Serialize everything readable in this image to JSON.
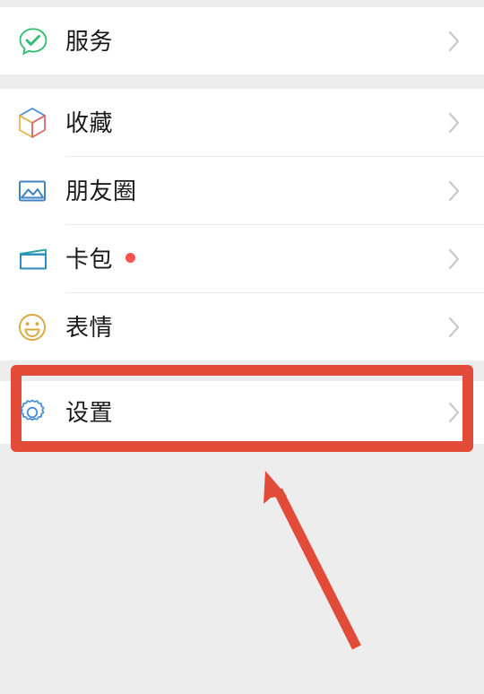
{
  "app": {
    "name": "WeChat Me tab",
    "background_color": "#ededed",
    "card_color": "#ffffff",
    "divider_color": "#e9e9e9",
    "label_color": "#1a1a1a",
    "chevron_color": "#c8c8c8",
    "badge_color": "#fa5151",
    "annotation_color": "#e24b38"
  },
  "groups": [
    {
      "id": "services-group",
      "items": [
        {
          "id": "services",
          "label": "服务",
          "icon": "speech-bubble-check-icon",
          "icon_color": "#2dbd6e",
          "chevron": "chevron-right-icon",
          "badge": null
        }
      ]
    },
    {
      "id": "content-group",
      "items": [
        {
          "id": "favorites",
          "label": "收藏",
          "icon": "cube-icon",
          "icon_color": "#4a90d9",
          "chevron": "chevron-right-icon",
          "badge": null
        },
        {
          "id": "moments",
          "label": "朋友圈",
          "icon": "photo-icon",
          "icon_color": "#3e82c4",
          "chevron": "chevron-right-icon",
          "badge": null
        },
        {
          "id": "cards",
          "label": "卡包",
          "icon": "wallet-icon",
          "icon_color": "#2e8bc0",
          "chevron": "chevron-right-icon",
          "badge": "red-dot"
        },
        {
          "id": "stickers",
          "label": "表情",
          "icon": "smiley-icon",
          "icon_color": "#d8a93c",
          "chevron": "chevron-right-icon",
          "badge": null
        }
      ]
    },
    {
      "id": "settings-group",
      "items": [
        {
          "id": "settings",
          "label": "设置",
          "icon": "gear-icon",
          "icon_color": "#4a90d9",
          "chevron": "chevron-right-icon",
          "badge": null
        }
      ]
    }
  ],
  "annotation": {
    "highlight_target": "设置",
    "rect_color": "#e24b38",
    "arrow_color": "#e24b38",
    "arrow_points_to": "设置"
  }
}
